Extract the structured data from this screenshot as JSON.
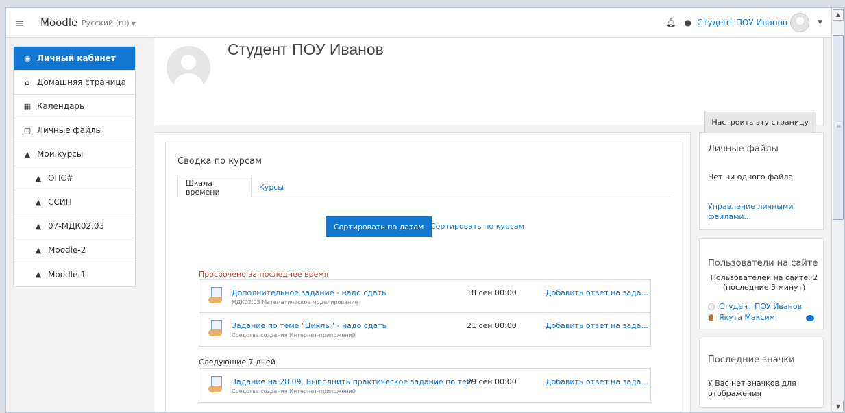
{
  "navbar": {
    "site_name": "Moodle",
    "language": "Русский (ru)",
    "user_name": "Студент ПОУ Иванов"
  },
  "sidebar": {
    "items": [
      {
        "label": "Личный кабинет",
        "icon": "dashboard-icon",
        "active": true
      },
      {
        "label": "Домашняя страница",
        "icon": "home-icon"
      },
      {
        "label": "Календарь",
        "icon": "calendar-icon"
      },
      {
        "label": "Личные файлы",
        "icon": "file-icon"
      },
      {
        "label": "Мои курсы",
        "icon": "graduation-cap-icon"
      },
      {
        "label": "ОПС#",
        "icon": "graduation-cap-icon"
      },
      {
        "label": "ССИП",
        "icon": "graduation-cap-icon"
      },
      {
        "label": "07-МДК02.03",
        "icon": "graduation-cap-icon"
      },
      {
        "label": "Moodle-2",
        "icon": "graduation-cap-icon"
      },
      {
        "label": "Moodle-1",
        "icon": "graduation-cap-icon"
      }
    ]
  },
  "profile": {
    "name": "Студент ПОУ Иванов",
    "customize_label": "Настроить эту страницу"
  },
  "course_overview": {
    "title": "Сводка по курсам",
    "tabs": [
      "Шкала времени",
      "Курсы"
    ],
    "sort_by_dates": "Сортировать по датам",
    "sort_by_courses": "Сортировать по курсам",
    "overdue_title": "Просрочено за последнее время",
    "next_title": "Следующие 7 дней",
    "overdue": [
      {
        "title": "Дополнительное задание - надо сдать",
        "course": "МДК02.03 Математическое моделирование",
        "date": "18 сен 00:00",
        "action": "Добавить ответ на зада..."
      },
      {
        "title": "Задание по теме \"Циклы\" - надо сдать",
        "course": "Средства создания Интернет-приложений",
        "date": "21 сен 00:00",
        "action": "Добавить ответ на зада..."
      }
    ],
    "next": [
      {
        "title": "Задание на 28.09. Выполнить практическое задание по тем...",
        "course": "Средства создания Интернет-приложений",
        "date": "29 сен 00:00",
        "action": "Добавить ответ на зада..."
      }
    ]
  },
  "blocks": {
    "private_files": {
      "title": "Личные файлы",
      "empty": "Нет ни одного файла",
      "manage": "Управление личными файлами..."
    },
    "online_users": {
      "title": "Пользователи на сайте",
      "count_line1": "Пользователей на сайте: 2",
      "count_line2": "(последние 5 минут)",
      "users": [
        "Студент ПОУ Иванов",
        "Якута Максим"
      ]
    },
    "badges": {
      "title": "Последние значки",
      "empty": "У Вас нет значков для отображения"
    }
  }
}
